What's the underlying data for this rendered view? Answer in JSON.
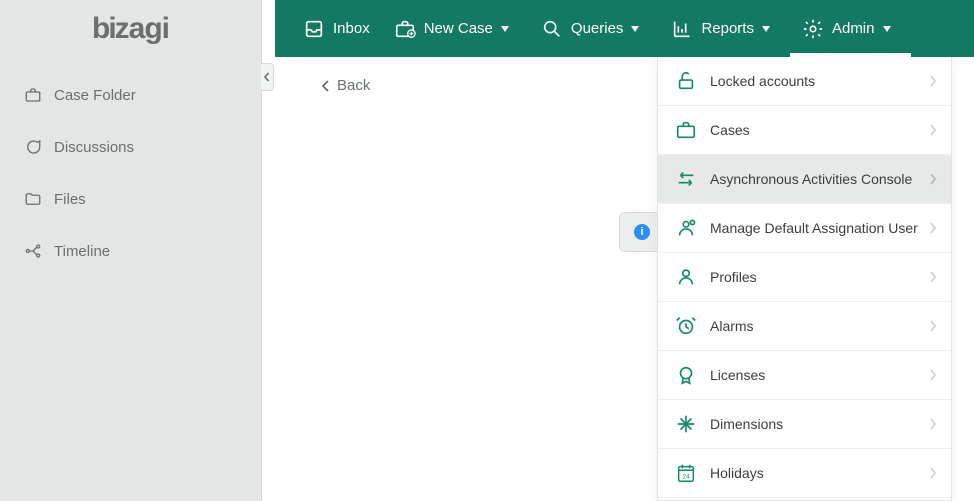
{
  "brand": "bizagi",
  "colors": {
    "accent": "#137963",
    "icon": "#128a6c",
    "muted": "#6a706f"
  },
  "sidebar": {
    "items": [
      {
        "label": "Case Folder"
      },
      {
        "label": "Discussions"
      },
      {
        "label": "Files"
      },
      {
        "label": "Timeline"
      }
    ]
  },
  "nav": {
    "inbox": {
      "label": "Inbox"
    },
    "newcase": {
      "label": "New Case"
    },
    "queries": {
      "label": "Queries"
    },
    "reports": {
      "label": "Reports"
    },
    "admin": {
      "label": "Admin"
    }
  },
  "main": {
    "back_label": "Back"
  },
  "admin_menu": {
    "items": [
      {
        "label": "Locked accounts"
      },
      {
        "label": "Cases"
      },
      {
        "label": "Asynchronous Activities Console"
      },
      {
        "label": "Manage Default Assignation User"
      },
      {
        "label": "Profiles"
      },
      {
        "label": "Alarms"
      },
      {
        "label": "Licenses"
      },
      {
        "label": "Dimensions"
      },
      {
        "label": "Holidays"
      }
    ]
  }
}
